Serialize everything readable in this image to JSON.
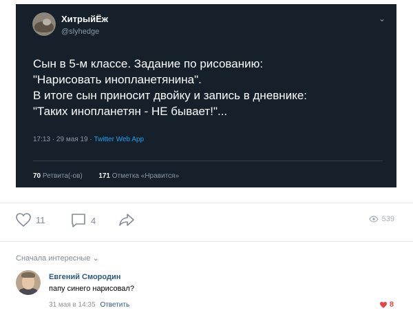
{
  "tweet": {
    "author_name": "ХитрыйЁж",
    "author_handle": "@slyhedge",
    "chevron": "⌄",
    "text": "Сын в 5-м классе. Задание по рисованию:\n\"Нарисовать инопланетянина\".\nВ итоге сын приносит двойку и запись в дневнике:\n\"Таких инопланетян - НЕ бывает!\"...",
    "time": "17:13 · 29 мая 19 · ",
    "source": "Twitter Web App",
    "retweets_count": "70",
    "retweets_label": "Ретвита(-ов)",
    "likes_count": "171",
    "likes_label": "Отметка «Нравится»"
  },
  "post_actions": {
    "likes": "11",
    "comments": "4",
    "views": "539",
    "icons": [
      "heart-icon",
      "comment-icon",
      "share-icon",
      "eye-icon"
    ]
  },
  "comments_sort": {
    "label": "Сначала интересные",
    "chevron": "⌄"
  },
  "comment": {
    "author": "Евгений Смородин",
    "text": "папу синего нарисовал?",
    "date": "31 мая в 14:35",
    "reply_label": "Ответить",
    "likes": "8"
  },
  "colors": {
    "tweet_bg": "#15202b",
    "link_blue": "#2a5885",
    "twitter_blue": "#1da1f2",
    "like_red": "#e64646"
  }
}
